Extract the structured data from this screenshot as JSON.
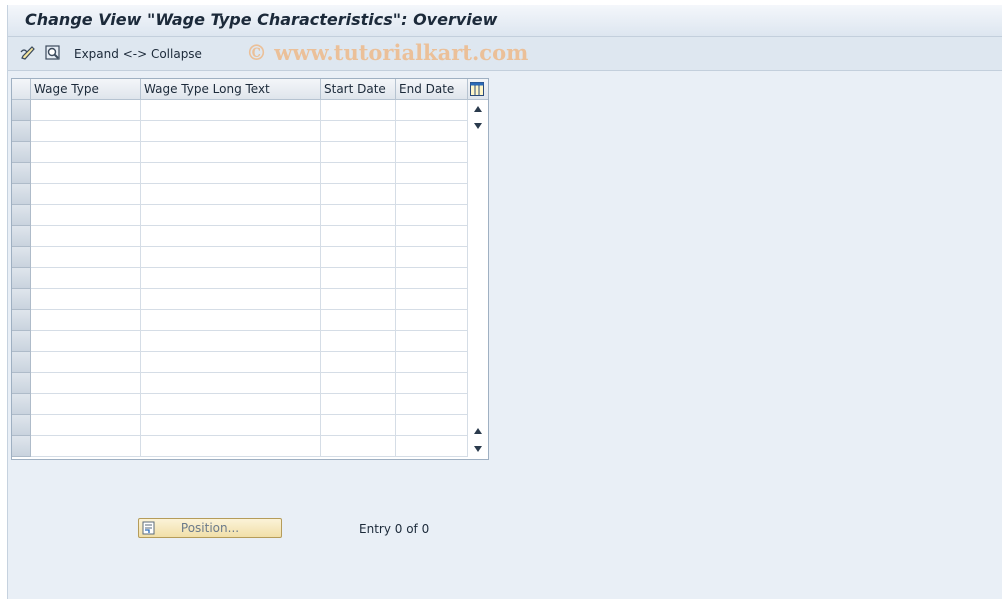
{
  "title": "Change View \"Wage Type Characteristics\": Overview",
  "toolbar": {
    "expand_collapse_label": "Expand <-> Collapse",
    "icons": [
      "display-change-icon",
      "details-icon"
    ]
  },
  "watermark": "© www.tutorialkart.com",
  "table": {
    "columns": [
      "Wage Type",
      "Wage Type Long Text",
      "Start Date",
      "End Date"
    ],
    "rows": [
      [
        "",
        "",
        "",
        ""
      ],
      [
        "",
        "",
        "",
        ""
      ],
      [
        "",
        "",
        "",
        ""
      ],
      [
        "",
        "",
        "",
        ""
      ],
      [
        "",
        "",
        "",
        ""
      ],
      [
        "",
        "",
        "",
        ""
      ],
      [
        "",
        "",
        "",
        ""
      ],
      [
        "",
        "",
        "",
        ""
      ],
      [
        "",
        "",
        "",
        ""
      ],
      [
        "",
        "",
        "",
        ""
      ],
      [
        "",
        "",
        "",
        ""
      ],
      [
        "",
        "",
        "",
        ""
      ],
      [
        "",
        "",
        "",
        ""
      ],
      [
        "",
        "",
        "",
        ""
      ],
      [
        "",
        "",
        "",
        ""
      ],
      [
        "",
        "",
        "",
        ""
      ],
      [
        "",
        "",
        "",
        ""
      ]
    ]
  },
  "footer": {
    "position_label": "Position...",
    "entry_text": "Entry 0 of 0"
  }
}
